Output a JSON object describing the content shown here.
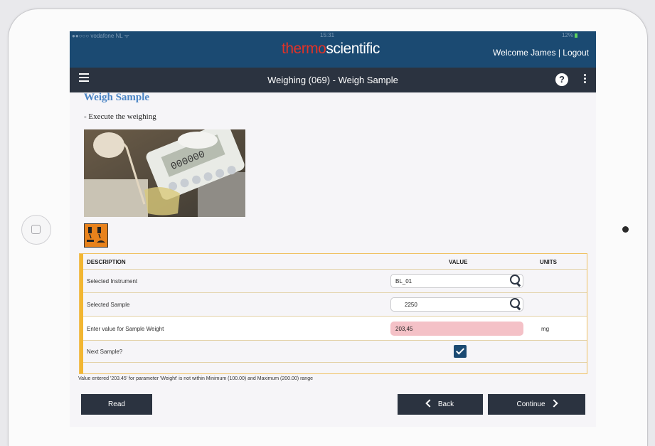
{
  "status_bar": {
    "carrier": "●●○○○ vodafone NL ᯤ",
    "time": "15:31",
    "battery": "12%"
  },
  "header": {
    "logo_part1": "thermo",
    "logo_part2": "scientific",
    "welcome": "Welcome James | Logout"
  },
  "titlebar": {
    "title": "Weighing (069) - Weigh Sample",
    "help_label": "?"
  },
  "content": {
    "heading": "Weigh Sample",
    "instruction": "- Execute the weighing"
  },
  "grid": {
    "col_description": "DESCRIPTION",
    "col_value": "VALUE",
    "col_units": "UNITS",
    "rows": [
      {
        "label": "Selected Instrument",
        "value": "BL_01"
      },
      {
        "label": "Selected Sample",
        "value": "2250"
      },
      {
        "label": "Enter value for Sample Weight",
        "value": "203,45",
        "units": "mg"
      },
      {
        "label": "Next Sample?",
        "checked": true
      }
    ]
  },
  "validation_message": "Value entered '203.45' for parameter 'Weight' is not within Minimum (100.00) and Maximum (200.00) range",
  "buttons": {
    "read": "Read",
    "back": "Back",
    "continue": "Continue"
  },
  "colors": {
    "header_bg": "#1b4a72",
    "titlebar_bg": "#2b3340",
    "logo_red": "#e23227",
    "heading_blue": "#4a84c4",
    "error_bg": "#f4c1c7",
    "accent_yellow": "#f2b632"
  }
}
